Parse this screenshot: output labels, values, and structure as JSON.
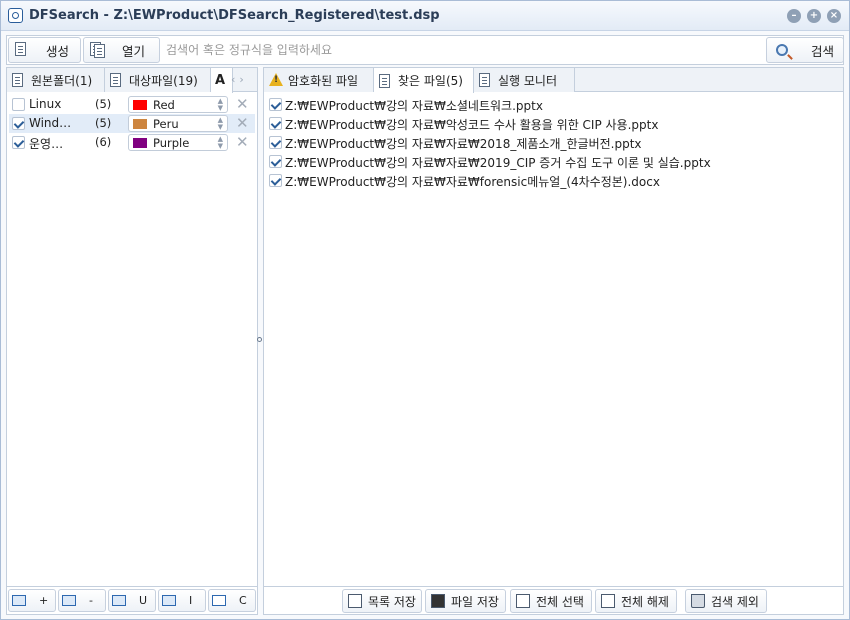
{
  "window": {
    "title": "DFSearch - Z:\\EWProduct\\DFSearch_Registered\\test.dsp"
  },
  "toolbar": {
    "create_label": "생성",
    "open_label": "열기",
    "search_placeholder": "검색어 혹은 정규식을 입력하세요",
    "search_label": "검색"
  },
  "left_tabs": {
    "source_folder": "원본폴더(1)",
    "target_files": "대상파일(19)",
    "font_tab": "A"
  },
  "os_list": [
    {
      "name": "Linux",
      "count": "(5)",
      "color_name": "Red",
      "color": "#ff0000",
      "checked": false
    },
    {
      "name": "Wind…",
      "count": "(5)",
      "color_name": "Peru",
      "color": "#cd853f",
      "checked": true
    },
    {
      "name": "운영…",
      "count": "(6)",
      "color_name": "Purple",
      "color": "#800080",
      "checked": true
    }
  ],
  "left_bottom": {
    "add": "+",
    "remove": "-",
    "u": "U",
    "i": "I",
    "c": "C"
  },
  "right_tabs": {
    "encrypted": "암호화된 파일",
    "found": "찾은 파일(5)",
    "monitor": "실행 모니터"
  },
  "files": [
    "Z:₩EWProduct₩강의 자료₩소셜네트워크.pptx",
    "Z:₩EWProduct₩강의 자료₩악성코드 수사 활용을 위한 CIP 사용.pptx",
    "Z:₩EWProduct₩강의 자료₩자료₩2018_제품소개_한글버전.pptx",
    "Z:₩EWProduct₩강의 자료₩자료₩2019_CIP 증거 수집 도구 이론 및 실습.pptx",
    "Z:₩EWProduct₩강의 자료₩자료₩forensic메뉴얼_(4차수정본).docx"
  ],
  "right_bottom": {
    "save_list": "목록 저장",
    "save_file": "파일 저장",
    "select_all": "전체 선택",
    "deselect_all": "전체 해제",
    "exclude": "검색 제외"
  }
}
